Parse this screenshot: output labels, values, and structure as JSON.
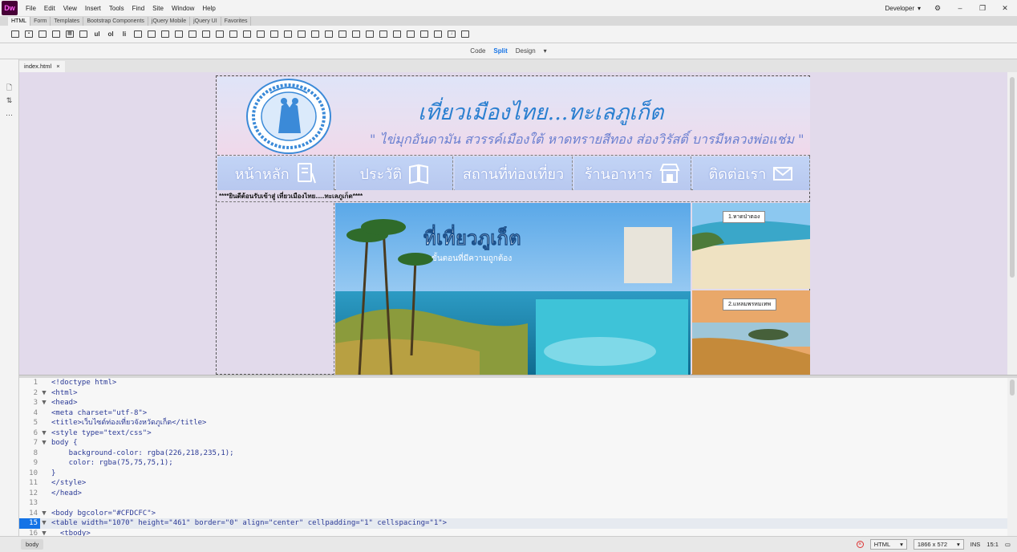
{
  "app": {
    "logo": "Dw",
    "menus": [
      "File",
      "Edit",
      "View",
      "Insert",
      "Tools",
      "Find",
      "Site",
      "Window",
      "Help"
    ],
    "workspace": "Developer"
  },
  "insert_tabs": [
    "HTML",
    "Form",
    "Templates",
    "Bootstrap Components",
    "jQuery Mobile",
    "jQuery UI",
    "Favorites"
  ],
  "insert_toolbar_text": [
    "ul",
    "ol",
    "li"
  ],
  "view_modes": [
    "Code",
    "Split",
    "Design"
  ],
  "document_tab": {
    "name": "index.html",
    "close": "×"
  },
  "design": {
    "title": "เที่ยวเมืองไทย...ทะเลภูเก็ต",
    "slogan": "\" ไข่มุกอันดามัน สวรรค์เมืองใต้ หาดทรายสีทอง ส่องวิรัสติ์ บารมีหลวงพ่อแช่ม \"",
    "nav": [
      {
        "label": "หน้าหลัก",
        "icon": "document-icon"
      },
      {
        "label": "ประวัติ",
        "icon": "book-icon"
      },
      {
        "label": "สถานที่ท่องเที่ยว",
        "icon": "map-icon"
      },
      {
        "label": "ร้านอาหาร",
        "icon": "store-icon"
      },
      {
        "label": "ติดต่อเรา",
        "icon": "mail-icon"
      }
    ],
    "marquee": "****ยินดีต้อนรับเข้าสู่ เที่ยวเมืองไทย.....ทะเลภูเก็ต****",
    "main_image_caption": "ที่เที่ยวภูเก็ต",
    "main_image_subcaption": "ขั้นตอนที่มีความถูกต้อง",
    "side_images": [
      "1.หาดป่าตอง",
      "2.แหลมพรหมเทพ"
    ]
  },
  "code_lines": [
    {
      "n": "1",
      "fold": "",
      "text": "<!doctype html>"
    },
    {
      "n": "2",
      "fold": "▼",
      "text": "<html>"
    },
    {
      "n": "3",
      "fold": "▼",
      "text": "<head>"
    },
    {
      "n": "4",
      "fold": "",
      "text": "<meta charset=\"utf-8\">"
    },
    {
      "n": "5",
      "fold": "",
      "text": "<title>เว็บไซต์ท่องเที่ยวจังหวัดภูเก็ต</title>"
    },
    {
      "n": "6",
      "fold": "▼",
      "text": "<style type=\"text/css\">"
    },
    {
      "n": "7",
      "fold": "▼",
      "text": "body {"
    },
    {
      "n": "8",
      "fold": "",
      "text": "    background-color: rgba(226,218,235,1);"
    },
    {
      "n": "9",
      "fold": "",
      "text": "    color: rgba(75,75,75,1);"
    },
    {
      "n": "10",
      "fold": "",
      "text": "}"
    },
    {
      "n": "11",
      "fold": "",
      "text": "</style>"
    },
    {
      "n": "12",
      "fold": "",
      "text": "</head>"
    },
    {
      "n": "13",
      "fold": "",
      "text": ""
    },
    {
      "n": "14",
      "fold": "▼",
      "text": "<body bgcolor=\"#CFDCFC\">"
    },
    {
      "n": "15",
      "fold": "▼",
      "text": "<table width=\"1070\" height=\"461\" border=\"0\" align=\"center\" cellpadding=\"1\" cellspacing=\"1\">"
    },
    {
      "n": "16",
      "fold": "▼",
      "text": "  <tbody>"
    }
  ],
  "active_line": "15",
  "status": {
    "tag": "body",
    "doc_type": "HTML",
    "dimensions": "1866 x 572",
    "mode": "INS",
    "position": "15:1"
  },
  "colors": {
    "accent": "#1473e6",
    "design_bg": "#e2daeb"
  }
}
